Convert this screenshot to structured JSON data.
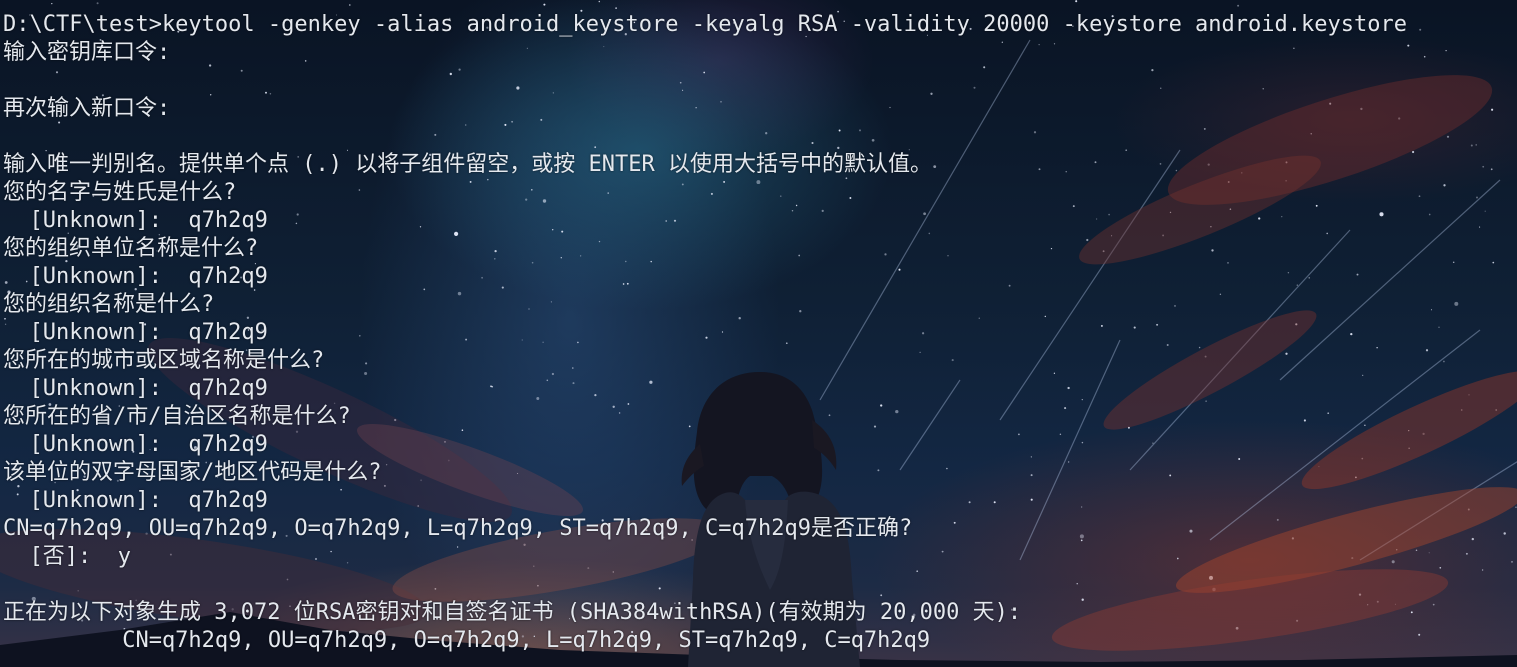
{
  "terminal": {
    "lines": [
      "D:\\CTF\\test>keytool -genkey -alias android_keystore -keyalg RSA -validity 20000 -keystore android.keystore",
      "输入密钥库口令:",
      "",
      "再次输入新口令:",
      "",
      "输入唯一判别名。提供单个点 (.) 以将子组件留空，或按 ENTER 以使用大括号中的默认值。",
      "您的名字与姓氏是什么?",
      "  [Unknown]:  q7h2q9",
      "您的组织单位名称是什么?",
      "  [Unknown]:  q7h2q9",
      "您的组织名称是什么?",
      "  [Unknown]:  q7h2q9",
      "您所在的城市或区域名称是什么?",
      "  [Unknown]:  q7h2q9",
      "您所在的省/市/自治区名称是什么?",
      "  [Unknown]:  q7h2q9",
      "该单位的双字母国家/地区代码是什么?",
      "  [Unknown]:  q7h2q9",
      "CN=q7h2q9, OU=q7h2q9, O=q7h2q9, L=q7h2q9, ST=q7h2q9, C=q7h2q9是否正确?",
      "  [否]:  y",
      "",
      "正在为以下对象生成 3,072 位RSA密钥对和自签名证书 (SHA384withRSA)(有效期为 20,000 天):",
      "         CN=q7h2q9, OU=q7h2q9, O=q7h2q9, L=q7h2q9, ST=q7h2q9, C=q7h2q9"
    ]
  },
  "colors": {
    "text": "#e4e8ee",
    "background": "#0b1526"
  }
}
